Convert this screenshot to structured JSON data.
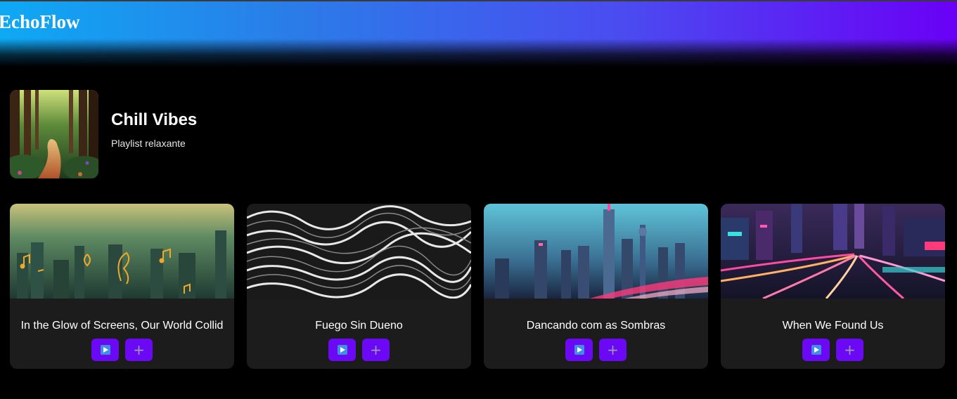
{
  "app": {
    "brand": "EchoFlow"
  },
  "playlist": {
    "title": "Chill Vibes",
    "subtitle": "Playlist relaxante",
    "cover_icon": "forest-path-image"
  },
  "tracks": [
    {
      "title": "In the Glow of Screens, Our World Collid",
      "art": "city-music-notes-image"
    },
    {
      "title": "Fuego Sin Dueno",
      "art": "wavy-lines-image"
    },
    {
      "title": "Dancando com as Sombras",
      "art": "neon-skyline-image"
    },
    {
      "title": "When We Found Us",
      "art": "neon-highway-image"
    }
  ],
  "buttons": {
    "play_icon": "play-icon",
    "add_icon": "plus-icon"
  },
  "colors": {
    "header_start": "#0ea9f4",
    "header_end": "#6a00f6",
    "button": "#6b08f4",
    "card_bg": "#1c1c1c",
    "page_bg": "#000000"
  }
}
